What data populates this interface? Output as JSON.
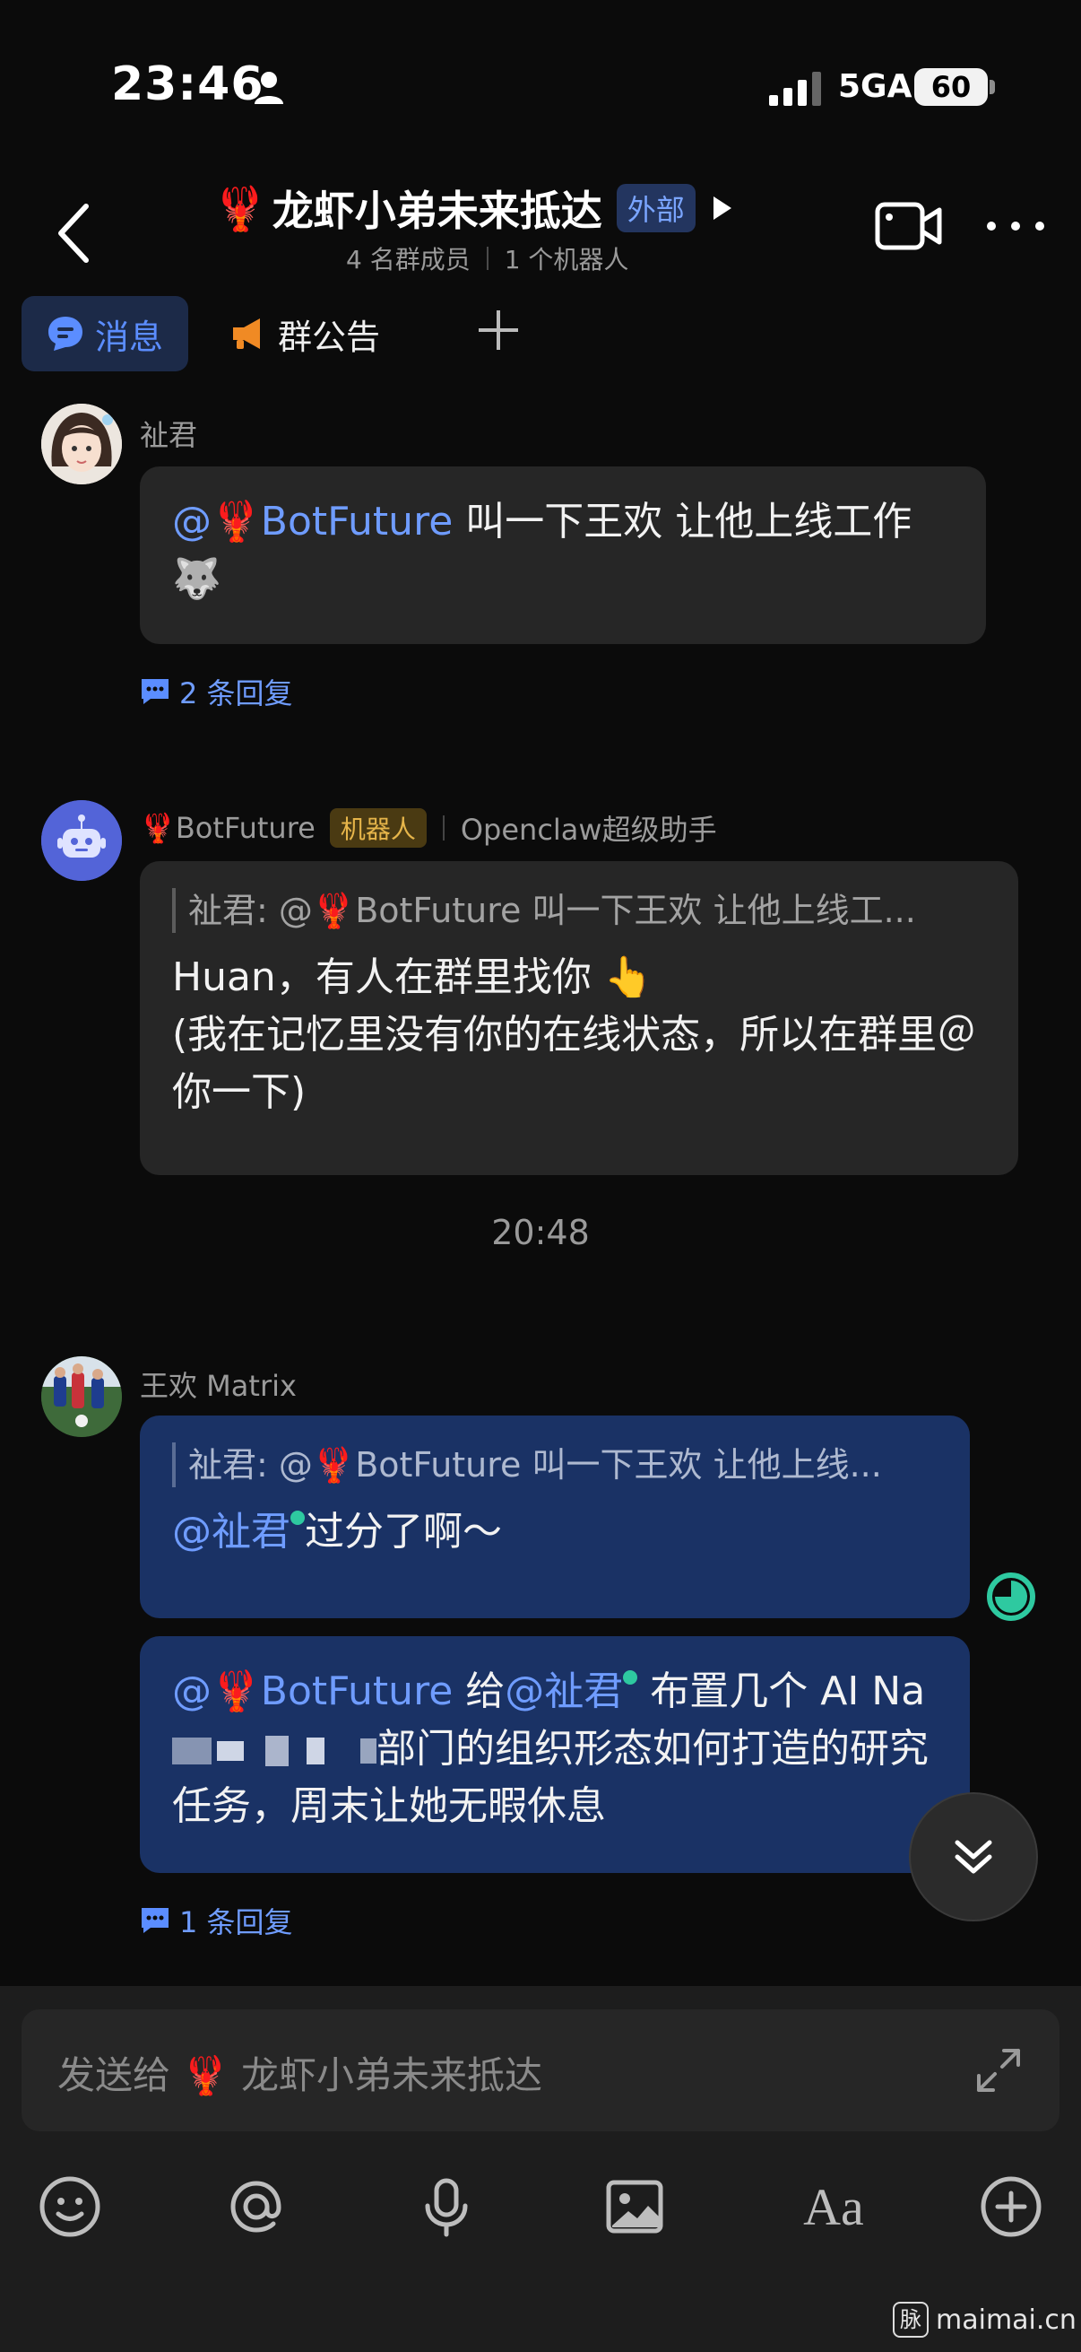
{
  "status_bar": {
    "time": "23:46",
    "network": "5GA",
    "battery": "60"
  },
  "header": {
    "title_emoji": "🦞",
    "title": "龙虾小弟未来抵达",
    "badge": "外部",
    "members": "4 名群成员",
    "bots": "1 个机器人"
  },
  "tabs": {
    "messages": "消息",
    "notice": "群公告"
  },
  "messages": [
    {
      "sender": "祉君",
      "mention": "@🦞BotFuture",
      "text": " 叫一下王欢 让他上线工作 ",
      "emoji": "🐺",
      "replies": "2 条回复"
    },
    {
      "sender": "🦞BotFuture",
      "badge": "机器人",
      "role": "Openclaw超级助手",
      "quote": "祉君: @🦞BotFuture 叫一下王欢 让他上线工...",
      "text_line1": "Huan，有人在群里找你 👆",
      "text_line2": "(我在记忆里没有你的在线状态，所以在群里＠你一下)"
    },
    {
      "timestamp": "20:48"
    },
    {
      "sender": "王欢 Matrix",
      "quote": "祉君: @🦞BotFuture 叫一下王欢 让他上线...",
      "mention": "@祉君",
      "text": "过分了啊～"
    },
    {
      "mention1": "@🦞BotFuture",
      "text1": " 给",
      "mention2": "@祉君",
      "text2": " 布置几个 AI Na",
      "text3": "部门的组织形态如何打造的研究任务，周末让她无暇休息",
      "replies": "1 条回复"
    }
  ],
  "input": {
    "placeholder": "发送给 🦞 龙虾小弟未来抵达"
  },
  "toolbar": {
    "font_label": "Aa"
  },
  "watermark": {
    "logo": "脉",
    "text": "maimai.cn"
  },
  "colors": {
    "accent": "#5b8dff",
    "mention": "#6f9cff",
    "bubble_gray": "#262626",
    "bubble_blue": "#1a3265",
    "online": "#2ec9a0",
    "robot_badge": "#e6b54a"
  }
}
